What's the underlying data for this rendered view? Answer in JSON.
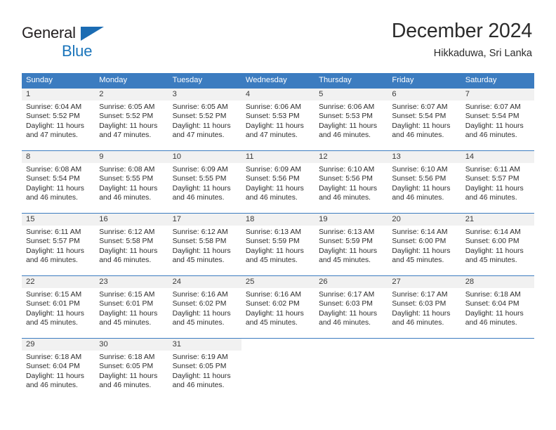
{
  "brand": {
    "line1": "General",
    "line2": "Blue",
    "color_dark": "#231f20",
    "color_blue": "#1b75bb"
  },
  "header": {
    "title": "December 2024",
    "subtitle": "Hikkaduwa, Sri Lanka"
  },
  "theme": {
    "header_blue": "#3c7cc0",
    "date_band": "#f1f1f1",
    "text": "#2d2d2d"
  },
  "labels": {
    "sunrise_prefix": "Sunrise:",
    "sunset_prefix": "Sunset:",
    "daylight_prefix": "Daylight:"
  },
  "weekdays": [
    "Sunday",
    "Monday",
    "Tuesday",
    "Wednesday",
    "Thursday",
    "Friday",
    "Saturday"
  ],
  "weeks": [
    [
      {
        "day": "1",
        "sunrise": "Sunrise: 6:04 AM",
        "sunset": "Sunset: 5:52 PM",
        "daylight_l1": "Daylight: 11 hours",
        "daylight_l2": "and 47 minutes."
      },
      {
        "day": "2",
        "sunrise": "Sunrise: 6:05 AM",
        "sunset": "Sunset: 5:52 PM",
        "daylight_l1": "Daylight: 11 hours",
        "daylight_l2": "and 47 minutes."
      },
      {
        "day": "3",
        "sunrise": "Sunrise: 6:05 AM",
        "sunset": "Sunset: 5:52 PM",
        "daylight_l1": "Daylight: 11 hours",
        "daylight_l2": "and 47 minutes."
      },
      {
        "day": "4",
        "sunrise": "Sunrise: 6:06 AM",
        "sunset": "Sunset: 5:53 PM",
        "daylight_l1": "Daylight: 11 hours",
        "daylight_l2": "and 47 minutes."
      },
      {
        "day": "5",
        "sunrise": "Sunrise: 6:06 AM",
        "sunset": "Sunset: 5:53 PM",
        "daylight_l1": "Daylight: 11 hours",
        "daylight_l2": "and 46 minutes."
      },
      {
        "day": "6",
        "sunrise": "Sunrise: 6:07 AM",
        "sunset": "Sunset: 5:54 PM",
        "daylight_l1": "Daylight: 11 hours",
        "daylight_l2": "and 46 minutes."
      },
      {
        "day": "7",
        "sunrise": "Sunrise: 6:07 AM",
        "sunset": "Sunset: 5:54 PM",
        "daylight_l1": "Daylight: 11 hours",
        "daylight_l2": "and 46 minutes."
      }
    ],
    [
      {
        "day": "8",
        "sunrise": "Sunrise: 6:08 AM",
        "sunset": "Sunset: 5:54 PM",
        "daylight_l1": "Daylight: 11 hours",
        "daylight_l2": "and 46 minutes."
      },
      {
        "day": "9",
        "sunrise": "Sunrise: 6:08 AM",
        "sunset": "Sunset: 5:55 PM",
        "daylight_l1": "Daylight: 11 hours",
        "daylight_l2": "and 46 minutes."
      },
      {
        "day": "10",
        "sunrise": "Sunrise: 6:09 AM",
        "sunset": "Sunset: 5:55 PM",
        "daylight_l1": "Daylight: 11 hours",
        "daylight_l2": "and 46 minutes."
      },
      {
        "day": "11",
        "sunrise": "Sunrise: 6:09 AM",
        "sunset": "Sunset: 5:56 PM",
        "daylight_l1": "Daylight: 11 hours",
        "daylight_l2": "and 46 minutes."
      },
      {
        "day": "12",
        "sunrise": "Sunrise: 6:10 AM",
        "sunset": "Sunset: 5:56 PM",
        "daylight_l1": "Daylight: 11 hours",
        "daylight_l2": "and 46 minutes."
      },
      {
        "day": "13",
        "sunrise": "Sunrise: 6:10 AM",
        "sunset": "Sunset: 5:56 PM",
        "daylight_l1": "Daylight: 11 hours",
        "daylight_l2": "and 46 minutes."
      },
      {
        "day": "14",
        "sunrise": "Sunrise: 6:11 AM",
        "sunset": "Sunset: 5:57 PM",
        "daylight_l1": "Daylight: 11 hours",
        "daylight_l2": "and 46 minutes."
      }
    ],
    [
      {
        "day": "15",
        "sunrise": "Sunrise: 6:11 AM",
        "sunset": "Sunset: 5:57 PM",
        "daylight_l1": "Daylight: 11 hours",
        "daylight_l2": "and 46 minutes."
      },
      {
        "day": "16",
        "sunrise": "Sunrise: 6:12 AM",
        "sunset": "Sunset: 5:58 PM",
        "daylight_l1": "Daylight: 11 hours",
        "daylight_l2": "and 46 minutes."
      },
      {
        "day": "17",
        "sunrise": "Sunrise: 6:12 AM",
        "sunset": "Sunset: 5:58 PM",
        "daylight_l1": "Daylight: 11 hours",
        "daylight_l2": "and 45 minutes."
      },
      {
        "day": "18",
        "sunrise": "Sunrise: 6:13 AM",
        "sunset": "Sunset: 5:59 PM",
        "daylight_l1": "Daylight: 11 hours",
        "daylight_l2": "and 45 minutes."
      },
      {
        "day": "19",
        "sunrise": "Sunrise: 6:13 AM",
        "sunset": "Sunset: 5:59 PM",
        "daylight_l1": "Daylight: 11 hours",
        "daylight_l2": "and 45 minutes."
      },
      {
        "day": "20",
        "sunrise": "Sunrise: 6:14 AM",
        "sunset": "Sunset: 6:00 PM",
        "daylight_l1": "Daylight: 11 hours",
        "daylight_l2": "and 45 minutes."
      },
      {
        "day": "21",
        "sunrise": "Sunrise: 6:14 AM",
        "sunset": "Sunset: 6:00 PM",
        "daylight_l1": "Daylight: 11 hours",
        "daylight_l2": "and 45 minutes."
      }
    ],
    [
      {
        "day": "22",
        "sunrise": "Sunrise: 6:15 AM",
        "sunset": "Sunset: 6:01 PM",
        "daylight_l1": "Daylight: 11 hours",
        "daylight_l2": "and 45 minutes."
      },
      {
        "day": "23",
        "sunrise": "Sunrise: 6:15 AM",
        "sunset": "Sunset: 6:01 PM",
        "daylight_l1": "Daylight: 11 hours",
        "daylight_l2": "and 45 minutes."
      },
      {
        "day": "24",
        "sunrise": "Sunrise: 6:16 AM",
        "sunset": "Sunset: 6:02 PM",
        "daylight_l1": "Daylight: 11 hours",
        "daylight_l2": "and 45 minutes."
      },
      {
        "day": "25",
        "sunrise": "Sunrise: 6:16 AM",
        "sunset": "Sunset: 6:02 PM",
        "daylight_l1": "Daylight: 11 hours",
        "daylight_l2": "and 45 minutes."
      },
      {
        "day": "26",
        "sunrise": "Sunrise: 6:17 AM",
        "sunset": "Sunset: 6:03 PM",
        "daylight_l1": "Daylight: 11 hours",
        "daylight_l2": "and 46 minutes."
      },
      {
        "day": "27",
        "sunrise": "Sunrise: 6:17 AM",
        "sunset": "Sunset: 6:03 PM",
        "daylight_l1": "Daylight: 11 hours",
        "daylight_l2": "and 46 minutes."
      },
      {
        "day": "28",
        "sunrise": "Sunrise: 6:18 AM",
        "sunset": "Sunset: 6:04 PM",
        "daylight_l1": "Daylight: 11 hours",
        "daylight_l2": "and 46 minutes."
      }
    ],
    [
      {
        "day": "29",
        "sunrise": "Sunrise: 6:18 AM",
        "sunset": "Sunset: 6:04 PM",
        "daylight_l1": "Daylight: 11 hours",
        "daylight_l2": "and 46 minutes."
      },
      {
        "day": "30",
        "sunrise": "Sunrise: 6:18 AM",
        "sunset": "Sunset: 6:05 PM",
        "daylight_l1": "Daylight: 11 hours",
        "daylight_l2": "and 46 minutes."
      },
      {
        "day": "31",
        "sunrise": "Sunrise: 6:19 AM",
        "sunset": "Sunset: 6:05 PM",
        "daylight_l1": "Daylight: 11 hours",
        "daylight_l2": "and 46 minutes."
      },
      {
        "day": "",
        "sunrise": "",
        "sunset": "",
        "daylight_l1": "",
        "daylight_l2": ""
      },
      {
        "day": "",
        "sunrise": "",
        "sunset": "",
        "daylight_l1": "",
        "daylight_l2": ""
      },
      {
        "day": "",
        "sunrise": "",
        "sunset": "",
        "daylight_l1": "",
        "daylight_l2": ""
      },
      {
        "day": "",
        "sunrise": "",
        "sunset": "",
        "daylight_l1": "",
        "daylight_l2": ""
      }
    ]
  ]
}
